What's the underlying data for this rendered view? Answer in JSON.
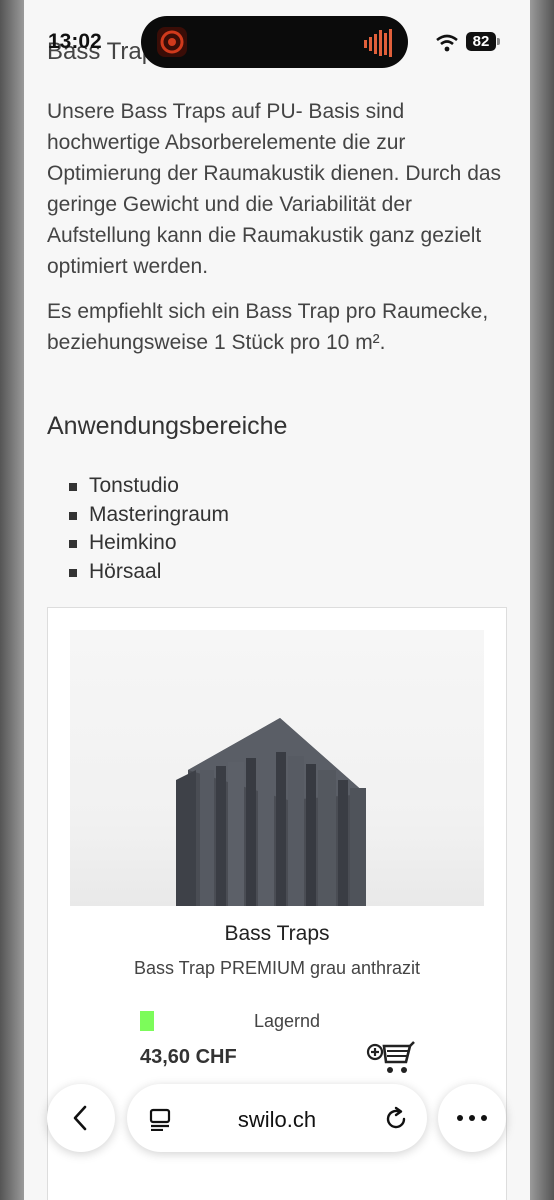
{
  "status": {
    "time": "13:02",
    "battery": "82"
  },
  "page": {
    "top_heading": "Bass Traps",
    "paragraph1": "Unsere Bass Traps auf PU- Basis sind hochwertige Absorberelemente die zur Optimierung der Raumakustik dienen. Durch das geringe Gewicht und die Variabilität der Aufstellung kann die Raumakustik ganz gezielt optimiert werden.",
    "paragraph2": "Es empfiehlt sich ein Bass Trap pro Raumecke, beziehungsweise 1 Stück pro 10 m².",
    "section_title": "Anwendungsbereiche",
    "applications": [
      "Tonstudio",
      "Masteringraum",
      "Heimkino",
      "Hörsaal"
    ]
  },
  "product": {
    "title": "Bass Traps",
    "subtitle": "Bass Trap PREMIUM grau anthrazit",
    "stock": "Lagernd",
    "price": "43,60 CHF",
    "stock_color": "#7CFC5A"
  },
  "browser": {
    "url": "swilo.ch"
  },
  "icons": {
    "back": "chevron-left-icon",
    "tabs": "tab-overview-icon",
    "reload": "reload-icon",
    "more": "more-icon",
    "cart": "add-to-cart-icon",
    "wifi": "wifi-icon"
  }
}
